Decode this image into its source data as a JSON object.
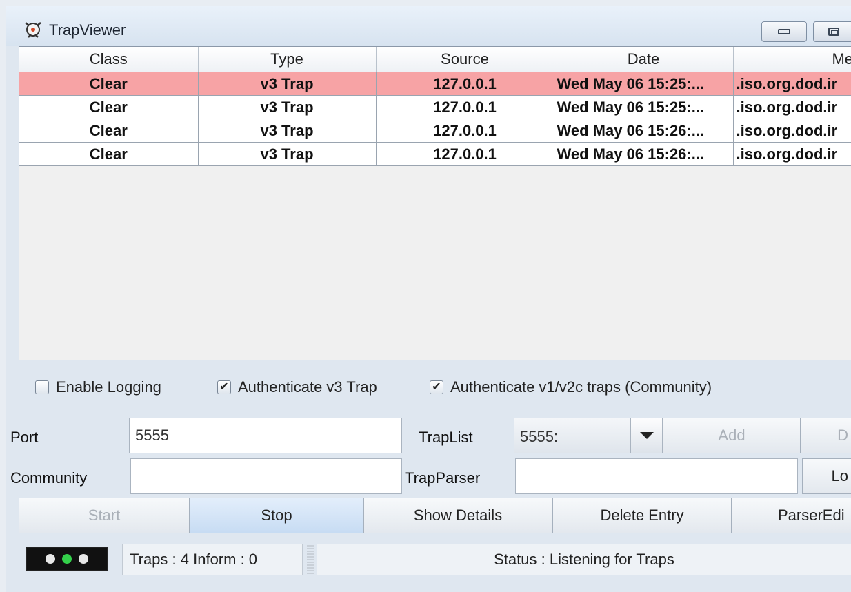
{
  "window": {
    "title": "TrapViewer"
  },
  "table": {
    "columns": [
      "Class",
      "Type",
      "Source",
      "Date",
      "Messag"
    ],
    "rows": [
      {
        "class": "Clear",
        "type": "v3 Trap",
        "source": "127.0.0.1",
        "date": "Wed May 06 15:25:...",
        "message": ".iso.org.dod.ir"
      },
      {
        "class": "Clear",
        "type": "v3 Trap",
        "source": "127.0.0.1",
        "date": "Wed May 06 15:25:...",
        "message": ".iso.org.dod.ir"
      },
      {
        "class": "Clear",
        "type": "v3 Trap",
        "source": "127.0.0.1",
        "date": "Wed May 06 15:26:...",
        "message": ".iso.org.dod.ir"
      },
      {
        "class": "Clear",
        "type": "v3 Trap",
        "source": "127.0.0.1",
        "date": "Wed May 06 15:26:...",
        "message": ".iso.org.dod.ir"
      }
    ],
    "selected_row_color": "#f7a3a5"
  },
  "options": {
    "enable_logging": {
      "label": "Enable Logging",
      "checked": false
    },
    "auth_v3": {
      "label": "Authenticate v3 Trap",
      "checked": true
    },
    "auth_v1v2c": {
      "label": "Authenticate v1/v2c traps (Community)",
      "checked": true
    }
  },
  "form": {
    "port_label": "Port",
    "port_value": "5555",
    "community_label": "Community",
    "community_value": "",
    "traplist_label": "TrapList",
    "traplist_value": "5555:",
    "trapparser_label": "TrapParser",
    "trapparser_value": "",
    "add_label": "Add",
    "delete_label": "D",
    "load_label": "Lo"
  },
  "buttons": {
    "start": "Start",
    "stop": "Stop",
    "show_details": "Show Details",
    "delete_entry": "Delete Entry",
    "parser_editor": "ParserEdi"
  },
  "status": {
    "counts": "Traps : 4 Inform : 0",
    "message": "Status : Listening for Traps",
    "lights": [
      "off",
      "green",
      "off"
    ]
  },
  "icons": {
    "app": "trap-viewer-icon",
    "minimize": "minimize-icon",
    "maximize": "maximize-icon",
    "dropdown": "chevron-down-icon"
  }
}
